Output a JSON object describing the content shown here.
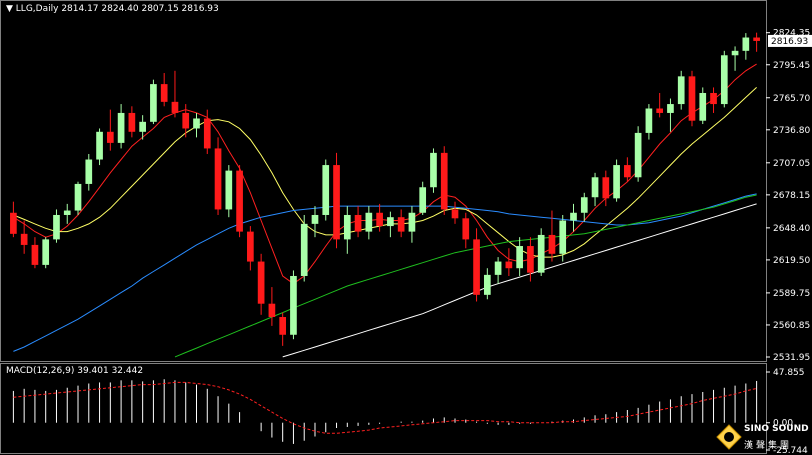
{
  "header": {
    "symbol": "LLG,Daily",
    "ohlc": "2814.17 2824.40 2807.15 2816.93"
  },
  "macd_header": "MACD(12,26,9) 39.401 32.442",
  "logo": {
    "line1": "SINO SOUND",
    "line2": "漢聲集團"
  },
  "colors": {
    "background": "#000000",
    "bull": "#a8ffa8",
    "bear": "#ff1a1a",
    "ma_fast": "#ff2020",
    "ma_medium": "#ffff66",
    "ma_60": "#2a8cff",
    "ma_120": "#1fbf1f",
    "ma_250": "#ffffff",
    "macd_hist": "#ffffff",
    "macd_signal": "#ff2020",
    "grid": "#404040"
  },
  "chart_data": [
    {
      "type": "candlestick",
      "title": "LLG,Daily",
      "ylim": [
        2531.95,
        2834.0
      ],
      "yticks": [
        "2824.35",
        "2795.45",
        "2765.70",
        "2736.80",
        "2707.05",
        "2678.15",
        "2648.40",
        "2619.50",
        "2589.75",
        "2560.85",
        "2531.95"
      ],
      "current_price": "2816.93",
      "candles": [
        [
          2662,
          2672,
          2640,
          2643
        ],
        [
          2643,
          2655,
          2625,
          2633
        ],
        [
          2633,
          2640,
          2612,
          2615
        ],
        [
          2615,
          2640,
          2612,
          2638
        ],
        [
          2638,
          2665,
          2635,
          2660
        ],
        [
          2660,
          2670,
          2652,
          2664
        ],
        [
          2664,
          2690,
          2660,
          2688
        ],
        [
          2688,
          2715,
          2682,
          2710
        ],
        [
          2710,
          2738,
          2705,
          2735
        ],
        [
          2735,
          2755,
          2718,
          2725
        ],
        [
          2725,
          2760,
          2720,
          2752
        ],
        [
          2752,
          2758,
          2730,
          2735
        ],
        [
          2735,
          2750,
          2728,
          2744
        ],
        [
          2744,
          2782,
          2742,
          2778
        ],
        [
          2778,
          2788,
          2758,
          2762
        ],
        [
          2762,
          2790,
          2748,
          2752
        ],
        [
          2752,
          2760,
          2730,
          2738
        ],
        [
          2738,
          2752,
          2730,
          2747
        ],
        [
          2747,
          2755,
          2715,
          2720
        ],
        [
          2720,
          2730,
          2660,
          2665
        ],
        [
          2665,
          2705,
          2658,
          2700
        ],
        [
          2700,
          2705,
          2640,
          2645
        ],
        [
          2645,
          2650,
          2610,
          2618
        ],
        [
          2618,
          2625,
          2570,
          2580
        ],
        [
          2580,
          2595,
          2560,
          2568
        ],
        [
          2568,
          2572,
          2542,
          2552
        ],
        [
          2552,
          2610,
          2548,
          2605
        ],
        [
          2605,
          2660,
          2600,
          2652
        ],
        [
          2652,
          2668,
          2640,
          2660
        ],
        [
          2660,
          2710,
          2655,
          2705
        ],
        [
          2705,
          2716,
          2630,
          2638
        ],
        [
          2638,
          2668,
          2625,
          2660
        ],
        [
          2660,
          2668,
          2640,
          2645
        ],
        [
          2645,
          2668,
          2638,
          2662
        ],
        [
          2662,
          2670,
          2645,
          2650
        ],
        [
          2650,
          2663,
          2640,
          2658
        ],
        [
          2658,
          2665,
          2640,
          2645
        ],
        [
          2645,
          2668,
          2635,
          2662
        ],
        [
          2662,
          2690,
          2660,
          2685
        ],
        [
          2685,
          2720,
          2680,
          2716
        ],
        [
          2716,
          2722,
          2660,
          2665
        ],
        [
          2665,
          2672,
          2652,
          2657
        ],
        [
          2657,
          2662,
          2630,
          2638
        ],
        [
          2638,
          2648,
          2582,
          2588
        ],
        [
          2588,
          2612,
          2584,
          2606
        ],
        [
          2606,
          2622,
          2598,
          2618
        ],
        [
          2618,
          2630,
          2605,
          2612
        ],
        [
          2612,
          2640,
          2605,
          2632
        ],
        [
          2632,
          2640,
          2600,
          2608
        ],
        [
          2608,
          2648,
          2605,
          2642
        ],
        [
          2642,
          2664,
          2618,
          2625
        ],
        [
          2625,
          2660,
          2618,
          2655
        ],
        [
          2655,
          2670,
          2645,
          2662
        ],
        [
          2662,
          2680,
          2654,
          2676
        ],
        [
          2676,
          2698,
          2668,
          2694
        ],
        [
          2694,
          2700,
          2668,
          2675
        ],
        [
          2675,
          2710,
          2672,
          2705
        ],
        [
          2705,
          2712,
          2690,
          2694
        ],
        [
          2694,
          2740,
          2690,
          2734
        ],
        [
          2734,
          2760,
          2728,
          2756
        ],
        [
          2756,
          2770,
          2748,
          2752
        ],
        [
          2752,
          2765,
          2735,
          2760
        ],
        [
          2760,
          2790,
          2755,
          2785
        ],
        [
          2785,
          2790,
          2740,
          2745
        ],
        [
          2745,
          2775,
          2742,
          2770
        ],
        [
          2770,
          2775,
          2752,
          2760
        ],
        [
          2760,
          2808,
          2757,
          2804
        ],
        [
          2804,
          2812,
          2790,
          2808
        ],
        [
          2808,
          2824,
          2800,
          2820
        ],
        [
          2820,
          2824.4,
          2807.15,
          2816.93
        ]
      ],
      "series": [
        {
          "name": "",
          "color_key": "ma_fast",
          "values": [
            2658,
            2652,
            2645,
            2640,
            2643,
            2650,
            2660,
            2672,
            2685,
            2698,
            2710,
            2722,
            2730,
            2738,
            2748,
            2752,
            2755,
            2752,
            2748,
            2735,
            2718,
            2702,
            2680,
            2655,
            2630,
            2605,
            2598,
            2605,
            2618,
            2632,
            2645,
            2652,
            2655,
            2655,
            2656,
            2655,
            2655,
            2657,
            2663,
            2672,
            2678,
            2676,
            2668,
            2655,
            2640,
            2628,
            2620,
            2618,
            2620,
            2625,
            2630,
            2636,
            2645,
            2655,
            2666,
            2675,
            2682,
            2690,
            2700,
            2712,
            2724,
            2734,
            2745,
            2752,
            2758,
            2764,
            2772,
            2782,
            2790,
            2796
          ]
        },
        {
          "name": "",
          "color_key": "ma_medium",
          "values": [
            2660,
            2656,
            2652,
            2648,
            2645,
            2645,
            2648,
            2652,
            2658,
            2666,
            2676,
            2686,
            2696,
            2706,
            2716,
            2726,
            2734,
            2740,
            2745,
            2746,
            2744,
            2738,
            2728,
            2714,
            2698,
            2680,
            2665,
            2652,
            2645,
            2642,
            2642,
            2644,
            2646,
            2648,
            2650,
            2652,
            2652,
            2653,
            2655,
            2659,
            2664,
            2666,
            2665,
            2660,
            2652,
            2644,
            2636,
            2629,
            2624,
            2622,
            2622,
            2624,
            2628,
            2634,
            2642,
            2650,
            2658,
            2666,
            2675,
            2685,
            2695,
            2705,
            2715,
            2724,
            2732,
            2740,
            2748,
            2757,
            2766,
            2775
          ]
        },
        {
          "name": "",
          "color_key": "ma_60",
          "values": [
            2537,
            2541,
            2546,
            2551,
            2556,
            2561,
            2566,
            2572,
            2578,
            2584,
            2590,
            2596,
            2603,
            2609,
            2615,
            2621,
            2627,
            2633,
            2638,
            2643,
            2648,
            2652,
            2655,
            2658,
            2660,
            2662,
            2664,
            2665,
            2666,
            2667,
            2668,
            2668,
            2668,
            2668,
            2668,
            2668,
            2668,
            2668,
            2668,
            2668,
            2668,
            2667,
            2666,
            2665,
            2664,
            2663,
            2661,
            2660,
            2659,
            2658,
            2657,
            2656,
            2655,
            2654,
            2653,
            2652,
            2651,
            2651,
            2652,
            2653,
            2655,
            2657,
            2659,
            2662,
            2665,
            2668,
            2671,
            2674,
            2677,
            2679
          ]
        },
        {
          "name": "",
          "color_key": "ma_120",
          "values": [
            null,
            null,
            null,
            null,
            null,
            null,
            null,
            null,
            null,
            null,
            null,
            null,
            null,
            null,
            null,
            2532,
            2536,
            2540,
            2544,
            2548,
            2552,
            2556,
            2560,
            2564,
            2568,
            2572,
            2576,
            2580,
            2584,
            2588,
            2592,
            2596,
            2599,
            2602,
            2605,
            2608,
            2611,
            2614,
            2617,
            2620,
            2623,
            2626,
            2628,
            2630,
            2632,
            2634,
            2636,
            2637,
            2638,
            2639,
            2640,
            2641,
            2642,
            2643,
            2645,
            2647,
            2649,
            2651,
            2653,
            2655,
            2657,
            2659,
            2661,
            2663,
            2665,
            2667,
            2670,
            2673,
            2676,
            2678
          ]
        },
        {
          "name": "",
          "color_key": "ma_250",
          "values": [
            null,
            null,
            null,
            null,
            null,
            null,
            null,
            null,
            null,
            null,
            null,
            null,
            null,
            null,
            null,
            null,
            null,
            null,
            null,
            null,
            null,
            null,
            null,
            null,
            null,
            2532,
            2535,
            2538,
            2541,
            2544,
            2547,
            2550,
            2553,
            2556,
            2559,
            2562,
            2565,
            2568,
            2571,
            2575,
            2579,
            2583,
            2587,
            2591,
            2595,
            2598,
            2601,
            2604,
            2607,
            2610,
            2613,
            2616,
            2619,
            2622,
            2625,
            2628,
            2631,
            2634,
            2637,
            2640,
            2643,
            2646,
            2649,
            2652,
            2655,
            2658,
            2661,
            2664,
            2667,
            2670
          ]
        }
      ]
    },
    {
      "type": "bar",
      "title": "MACD(12,26,9) 39.401 32.442",
      "ylim": [
        -25.744,
        47.855
      ],
      "yticks": [
        "47.855",
        "0.00",
        "-25.744"
      ],
      "values": [
        30,
        32,
        31,
        30,
        31,
        33,
        35,
        37,
        38,
        38,
        40,
        40,
        39,
        40,
        41,
        40,
        38,
        36,
        32,
        25,
        18,
        10,
        0,
        -8,
        -14,
        -18,
        -20,
        -17,
        -13,
        -9,
        -5,
        -4,
        -3,
        -2,
        -1,
        0,
        1,
        1,
        2,
        4,
        5,
        4,
        3,
        1,
        -1,
        -2,
        -2,
        -1,
        -1,
        0,
        1,
        2,
        3,
        5,
        7,
        8,
        10,
        12,
        14,
        17,
        20,
        22,
        25,
        27,
        29,
        31,
        33,
        35,
        37,
        39.4
      ],
      "signal": [
        24,
        25,
        26,
        27,
        28,
        29,
        30,
        31,
        32,
        33,
        34,
        35,
        36,
        36,
        37,
        38,
        38,
        37,
        36,
        34,
        31,
        27,
        22,
        16,
        10,
        4,
        -1,
        -5,
        -8,
        -10,
        -10,
        -9,
        -8,
        -7,
        -5,
        -4,
        -3,
        -2,
        -1,
        0,
        1,
        2,
        2,
        2,
        2,
        1,
        1,
        0,
        0,
        0,
        0,
        1,
        1,
        2,
        3,
        4,
        5,
        6,
        8,
        10,
        12,
        14,
        16,
        18,
        21,
        23,
        25,
        27,
        30,
        32.4
      ]
    }
  ]
}
